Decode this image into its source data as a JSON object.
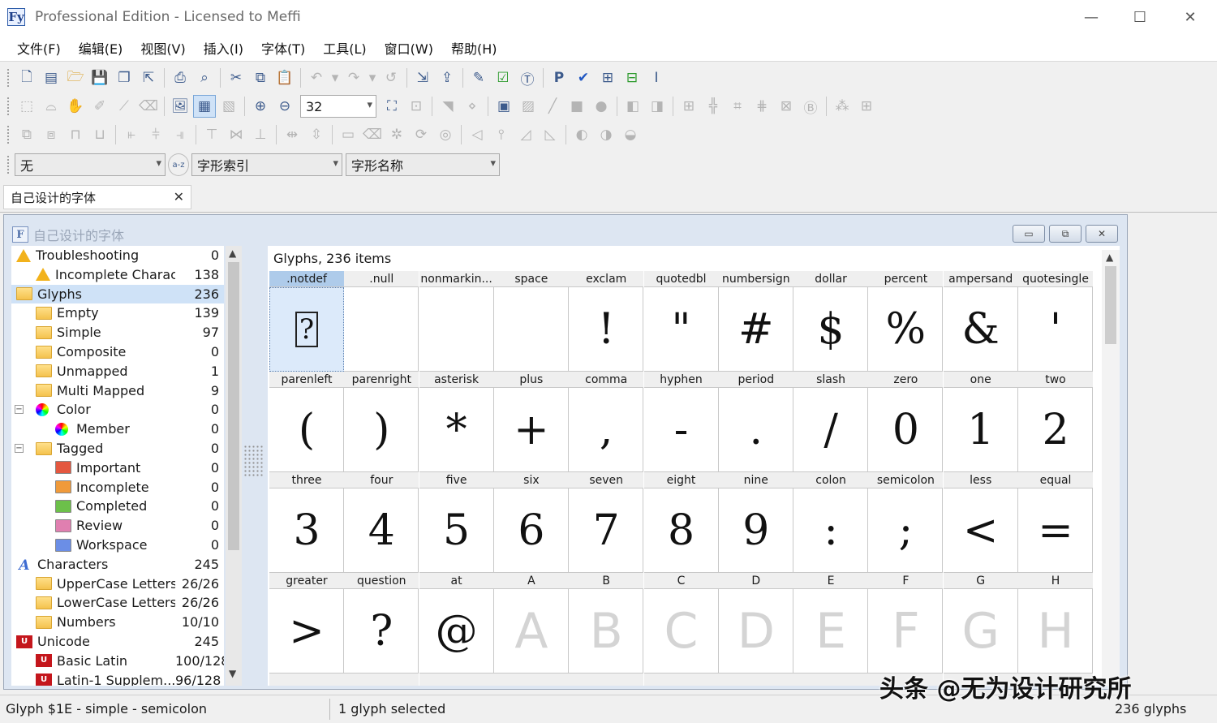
{
  "window": {
    "title": "Professional Edition - Licensed to Meffi",
    "app_icon": "Fy"
  },
  "menu": [
    "文件(F)",
    "编辑(E)",
    "视图(V)",
    "插入(I)",
    "字体(T)",
    "工具(L)",
    "窗口(W)",
    "帮助(H)"
  ],
  "toolbar": {
    "zoom_value": "32"
  },
  "filters": {
    "combo1": "无",
    "combo2": "字形索引",
    "combo3": "字形名称",
    "sort_icon": "a-z"
  },
  "doc_tab": {
    "label": "自己设计的字体"
  },
  "mdi": {
    "title": "自己设计的字体"
  },
  "tree": [
    {
      "label": "Troubleshooting",
      "count": "0",
      "icon": "warning-icon"
    },
    {
      "label": "Incomplete Charact...",
      "count": "138",
      "icon": "warning-icon"
    },
    {
      "label": "Glyphs",
      "count": "236",
      "icon": "folder-icon"
    },
    {
      "label": "Empty",
      "count": "139",
      "icon": "folder-icon"
    },
    {
      "label": "Simple",
      "count": "97",
      "icon": "folder-icon"
    },
    {
      "label": "Composite",
      "count": "0",
      "icon": "folder-icon"
    },
    {
      "label": "Unmapped",
      "count": "1",
      "icon": "folder-icon"
    },
    {
      "label": "Multi Mapped",
      "count": "9",
      "icon": "folder-icon"
    },
    {
      "label": "Color",
      "count": "0",
      "icon": "color-wheel-icon"
    },
    {
      "label": "Member",
      "count": "0",
      "icon": "color-wheel-icon"
    },
    {
      "label": "Tagged",
      "count": "0",
      "icon": "folder-icon"
    },
    {
      "label": "Important",
      "count": "0",
      "icon": "red-flag-icon"
    },
    {
      "label": "Incomplete",
      "count": "0",
      "icon": "orange-flag-icon"
    },
    {
      "label": "Completed",
      "count": "0",
      "icon": "green-flag-icon"
    },
    {
      "label": "Review",
      "count": "0",
      "icon": "pink-flag-icon"
    },
    {
      "label": "Workspace",
      "count": "0",
      "icon": "blue-flag-icon"
    },
    {
      "label": "Characters",
      "count": "245",
      "icon": "characters-icon"
    },
    {
      "label": "UpperCase Letters",
      "count": "26/26",
      "icon": "folder-icon"
    },
    {
      "label": "LowerCase Letters",
      "count": "26/26",
      "icon": "folder-icon"
    },
    {
      "label": "Numbers",
      "count": "10/10",
      "icon": "folder-icon"
    },
    {
      "label": "Unicode",
      "count": "245",
      "icon": "unicode-icon"
    },
    {
      "label": "Basic Latin",
      "count": "100/128",
      "icon": "unicode-icon"
    },
    {
      "label": "Latin-1 Supplem...",
      "count": "96/128",
      "icon": "unicode-icon"
    }
  ],
  "glyphs_header": "Glyphs, 236 items",
  "glyphs": [
    {
      "name": ".notdef",
      "char": "?"
    },
    {
      "name": ".null",
      "char": ""
    },
    {
      "name": "nonmarkin...",
      "char": ""
    },
    {
      "name": "space",
      "char": ""
    },
    {
      "name": "exclam",
      "char": "!"
    },
    {
      "name": "quotedbl",
      "char": "\""
    },
    {
      "name": "numbersign",
      "char": "#"
    },
    {
      "name": "dollar",
      "char": "$"
    },
    {
      "name": "percent",
      "char": "%"
    },
    {
      "name": "ampersand",
      "char": "&"
    },
    {
      "name": "quotesingle",
      "char": "'"
    },
    {
      "name": "parenleft",
      "char": "("
    },
    {
      "name": "parenright",
      "char": ")"
    },
    {
      "name": "asterisk",
      "char": "*"
    },
    {
      "name": "plus",
      "char": "+"
    },
    {
      "name": "comma",
      "char": ","
    },
    {
      "name": "hyphen",
      "char": "-"
    },
    {
      "name": "period",
      "char": "."
    },
    {
      "name": "slash",
      "char": "/"
    },
    {
      "name": "zero",
      "char": "0"
    },
    {
      "name": "one",
      "char": "1"
    },
    {
      "name": "two",
      "char": "2"
    },
    {
      "name": "three",
      "char": "3"
    },
    {
      "name": "four",
      "char": "4"
    },
    {
      "name": "five",
      "char": "5"
    },
    {
      "name": "six",
      "char": "6"
    },
    {
      "name": "seven",
      "char": "7"
    },
    {
      "name": "eight",
      "char": "8"
    },
    {
      "name": "nine",
      "char": "9"
    },
    {
      "name": "colon",
      "char": ":"
    },
    {
      "name": "semicolon",
      "char": ";"
    },
    {
      "name": "less",
      "char": "<"
    },
    {
      "name": "equal",
      "char": "="
    },
    {
      "name": "greater",
      "char": ">"
    },
    {
      "name": "question",
      "char": "?"
    },
    {
      "name": "at",
      "char": "@"
    },
    {
      "name": "A",
      "char": "A",
      "empty": true
    },
    {
      "name": "B",
      "char": "B",
      "empty": true
    },
    {
      "name": "C",
      "char": "C",
      "empty": true
    },
    {
      "name": "D",
      "char": "D",
      "empty": true
    },
    {
      "name": "E",
      "char": "E",
      "empty": true
    },
    {
      "name": "F",
      "char": "F",
      "empty": true
    },
    {
      "name": "G",
      "char": "G",
      "empty": true
    },
    {
      "name": "H",
      "char": "H",
      "empty": true
    }
  ],
  "status": {
    "left": "Glyph $1E - simple - semicolon",
    "middle": "1 glyph selected",
    "right": "236 glyphs"
  },
  "watermark": "头条 @无为设计研究所"
}
